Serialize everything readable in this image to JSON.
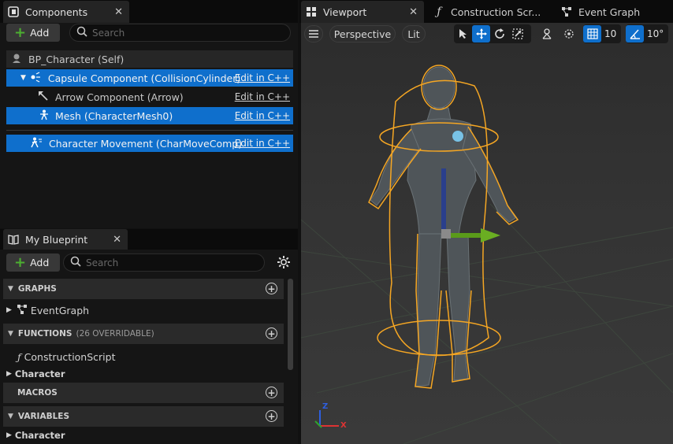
{
  "components_panel": {
    "title": "Components",
    "add_label": "Add",
    "search_placeholder": "Search",
    "self_item": "BP_Character (Self)",
    "items": [
      {
        "label": "Capsule Component (CollisionCylinder)",
        "action": "Edit in C++",
        "selected": true
      },
      {
        "label": "Arrow Component (Arrow)",
        "action": "Edit in C++",
        "selected": false
      },
      {
        "label": "Mesh (CharacterMesh0)",
        "action": "Edit in C++",
        "selected": true
      },
      {
        "label": "Character Movement (CharMoveComp)",
        "action": "Edit in C++",
        "selected": true
      }
    ]
  },
  "blueprint_panel": {
    "title": "My Blueprint",
    "add_label": "Add",
    "search_placeholder": "Search",
    "sections": {
      "graphs": "GRAPHS",
      "functions": "FUNCTIONS",
      "functions_note": "(26 OVERRIDABLE)",
      "macros": "MACROS",
      "variables": "VARIABLES"
    },
    "items": {
      "event_graph": "EventGraph",
      "construction_script": "ConstructionScript",
      "character_category_1": "Character",
      "character_category_2": "Character"
    }
  },
  "viewport": {
    "tabs": [
      {
        "label": "Viewport"
      },
      {
        "label": "Construction Scr..."
      },
      {
        "label": "Event Graph"
      }
    ],
    "toolbar": {
      "perspective": "Perspective",
      "lit": "Lit",
      "grid_size": "10",
      "rotation_snap": "10°"
    },
    "axis_labels": {
      "x": "X",
      "z": "Z"
    }
  },
  "colors": {
    "accent": "#0f6fcc",
    "selection_outline": "#f5a623",
    "add_plus": "#4caf31",
    "panel_bg": "#151515",
    "viewport_bg": "#3a3a3a"
  }
}
